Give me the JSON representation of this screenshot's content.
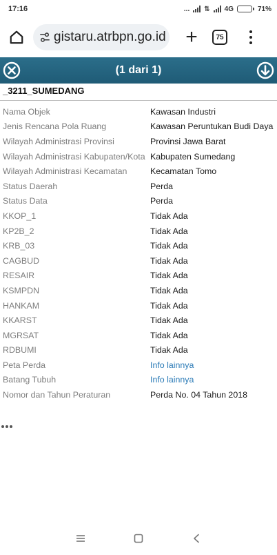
{
  "status_bar": {
    "time": "17:16",
    "dots": "...",
    "network": "4G",
    "battery_pct": "71%",
    "battery_level": 0.71
  },
  "browser": {
    "url": "gistaru.atrbpn.go.id",
    "tab_count": "75",
    "icons": {
      "home": "home-icon",
      "site_info": "tune-icon",
      "new_tab": "plus-icon",
      "more": "more-vert-icon"
    }
  },
  "popup": {
    "title": "(1 dari 1)",
    "layer_title": "_3211_SUMEDANG",
    "header_color": "#215e79",
    "link_color": "#2a7ab6",
    "rows": [
      {
        "key": "Nama Objek",
        "value": "Kawasan Industri"
      },
      {
        "key": "Jenis Rencana Pola Ruang",
        "value": "Kawasan Peruntukan Budi Daya"
      },
      {
        "key": "Wilayah Administrasi Provinsi",
        "value": "Provinsi Jawa Barat"
      },
      {
        "key": "Wilayah Administrasi Kabupaten/Kota",
        "value": "Kabupaten Sumedang"
      },
      {
        "key": "Wilayah Administrasi Kecamatan",
        "value": "Kecamatan Tomo"
      },
      {
        "key": "Status Daerah",
        "value": "Perda"
      },
      {
        "key": "Status Data",
        "value": "Perda"
      },
      {
        "key": "KKOP_1",
        "value": "Tidak Ada"
      },
      {
        "key": "KP2B_2",
        "value": "Tidak Ada"
      },
      {
        "key": "KRB_03",
        "value": "Tidak Ada"
      },
      {
        "key": "CAGBUD",
        "value": "Tidak Ada"
      },
      {
        "key": "RESAIR",
        "value": "Tidak Ada"
      },
      {
        "key": "KSMPDN",
        "value": "Tidak Ada"
      },
      {
        "key": "HANKAM",
        "value": "Tidak Ada"
      },
      {
        "key": "KKARST",
        "value": "Tidak Ada"
      },
      {
        "key": "MGRSAT",
        "value": "Tidak Ada"
      },
      {
        "key": "RDBUMI",
        "value": "Tidak Ada"
      },
      {
        "key": "Peta Perda",
        "value": "Info lainnya",
        "link": true
      },
      {
        "key": "Batang Tubuh",
        "value": "Info lainnya",
        "link": true
      },
      {
        "key": "Nomor dan Tahun Peraturan",
        "value": "Perda No. 04 Tahun 2018"
      }
    ]
  }
}
